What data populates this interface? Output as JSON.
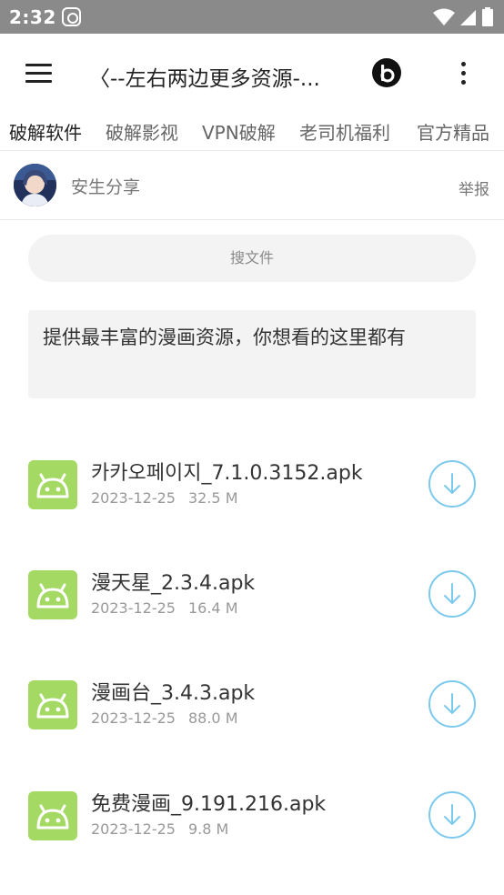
{
  "status_bar": {
    "time": "2:32"
  },
  "toolbar": {
    "title": "〈--左右两边更多资源-..."
  },
  "tabs": [
    {
      "label": "破解软件",
      "active": true
    },
    {
      "label": "破解影视",
      "active": false
    },
    {
      "label": "VPN破解",
      "active": false
    },
    {
      "label": "老司机福利",
      "active": false
    },
    {
      "label": "官方精品",
      "active": false
    }
  ],
  "author": {
    "name": "安生分享",
    "report_label": "举报"
  },
  "search": {
    "label": "搜文件"
  },
  "description": "提供最丰富的漫画资源，你想看的这里都有",
  "files": [
    {
      "name": "카카오페이지_7.1.0.3152.apk",
      "date": "2023-12-25",
      "size": "32.5 M"
    },
    {
      "name": "漫天星_2.3.4.apk",
      "date": "2023-12-25",
      "size": "16.4 M"
    },
    {
      "name": "漫画台_3.4.3.apk",
      "date": "2023-12-25",
      "size": "88.0 M"
    },
    {
      "name": "免费漫画_9.191.216.apk",
      "date": "2023-12-25",
      "size": "9.8 M"
    }
  ],
  "colors": {
    "status_bar": "#8a8a8a",
    "apk_icon": "#a4d964",
    "download_accent": "#7cc9ee"
  },
  "icons": {
    "menu": "hamburger-icon",
    "logo": "b-logo-icon",
    "more": "more-vertical-icon",
    "apk": "android-icon",
    "download": "download-icon"
  }
}
